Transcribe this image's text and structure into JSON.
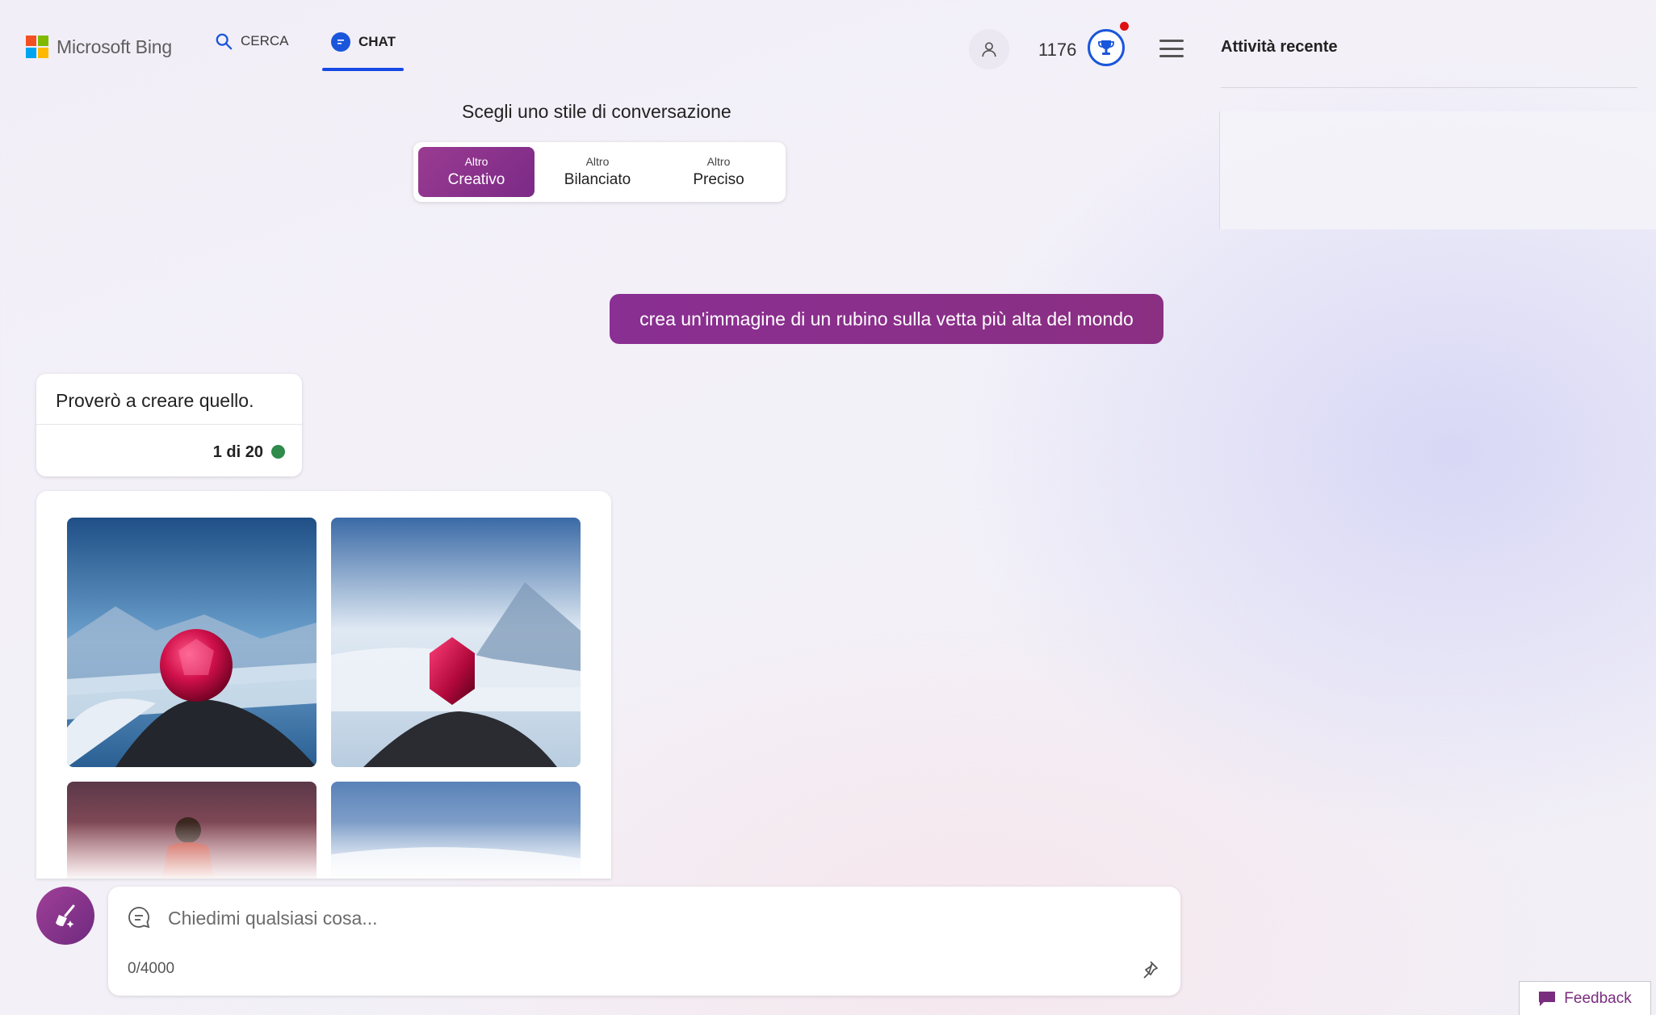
{
  "header": {
    "brand": "Microsoft Bing",
    "nav": {
      "search_label": "CERCA",
      "chat_label": "CHAT"
    },
    "points": "1176"
  },
  "recent": {
    "title": "Attività recente"
  },
  "style_picker": {
    "title": "Scegli uno stile di conversazione",
    "options": [
      {
        "sub": "Altro",
        "label": "Creativo",
        "active": true
      },
      {
        "sub": "Altro",
        "label": "Bilanciato",
        "active": false
      },
      {
        "sub": "Altro",
        "label": "Preciso",
        "active": false
      }
    ]
  },
  "conversation": {
    "user_message": "crea un'immagine di un rubino sulla vetta più alta del mondo",
    "bot_message": "Proverò a creare quello.",
    "turn_counter": "1 di 20"
  },
  "composer": {
    "placeholder": "Chiedimi qualsiasi cosa...",
    "char_count": "0/4000"
  },
  "feedback": {
    "label": "Feedback"
  },
  "colors": {
    "accent_blue": "#1a56db",
    "creative_purple": "#8a2f93",
    "status_green": "#2e8b49",
    "notification_red": "#dd1111"
  }
}
